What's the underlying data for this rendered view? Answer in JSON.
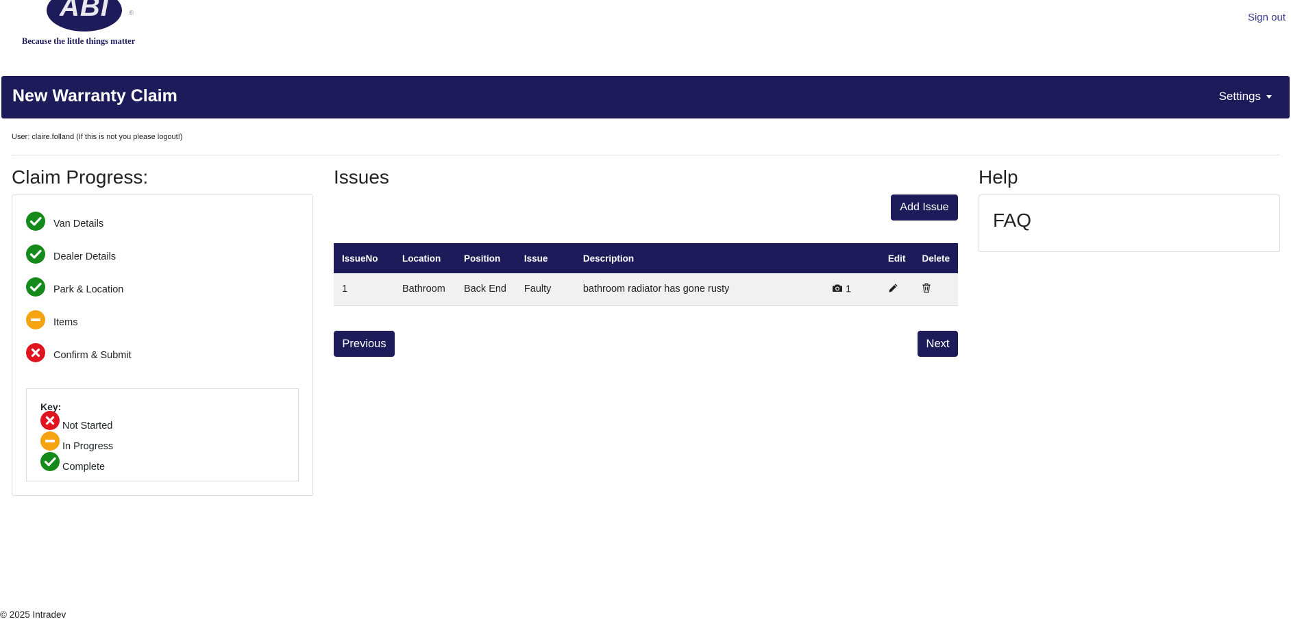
{
  "brand": {
    "logo_text": "ABI",
    "tagline": "Because the little things matter",
    "colors": {
      "primary": "#1e1b5a",
      "complete": "#138a1a",
      "in_progress": "#f6a312",
      "not_started": "#e0141f"
    }
  },
  "header": {
    "sign_out": "Sign out"
  },
  "navbar": {
    "title": "New Warranty Claim",
    "settings": "Settings"
  },
  "user_line": "User: claire.folland (If this is not you please logout!)",
  "progress": {
    "heading": "Claim Progress:",
    "steps": [
      {
        "label": "Van Details",
        "status": "complete"
      },
      {
        "label": "Dealer Details",
        "status": "complete"
      },
      {
        "label": "Park & Location",
        "status": "complete"
      },
      {
        "label": "Items",
        "status": "in-progress"
      },
      {
        "label": "Confirm & Submit",
        "status": "not-started"
      }
    ],
    "key": {
      "title": "Key:",
      "items": [
        {
          "label": "Not Started",
          "status": "not-started"
        },
        {
          "label": "In Progress",
          "status": "in-progress"
        },
        {
          "label": "Complete",
          "status": "complete"
        }
      ]
    }
  },
  "issues": {
    "heading": "Issues",
    "add_button": "Add Issue",
    "columns": [
      "IssueNo",
      "Location",
      "Position",
      "Issue",
      "Description",
      "",
      "Edit",
      "Delete"
    ],
    "rows": [
      {
        "issue_no": "1",
        "location": "Bathroom",
        "position": "Back End",
        "issue": "Faulty",
        "description": "bathroom radiator has gone rusty",
        "photo_count": "1"
      }
    ],
    "previous": "Previous",
    "next": "Next"
  },
  "help": {
    "heading": "Help",
    "faq": "FAQ"
  },
  "footer": "© 2025 Intradev",
  "icons": {
    "camera": "camera-icon",
    "edit": "pencil-icon",
    "delete": "trash-icon"
  }
}
